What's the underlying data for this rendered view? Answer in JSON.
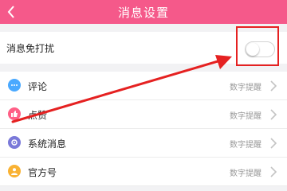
{
  "header": {
    "title": "消息设置"
  },
  "dnd": {
    "label": "消息免打扰",
    "enabled": false
  },
  "items": [
    {
      "label": "评论",
      "value": "数字提醒",
      "icon": "comment-icon",
      "color": "#4aa9ff"
    },
    {
      "label": "点赞",
      "value": "数字提醒",
      "icon": "thumbs-up-icon",
      "color": "#ff5f86"
    },
    {
      "label": "系统消息",
      "value": "数字提醒",
      "icon": "system-gear-icon",
      "color": "#7a79d9"
    },
    {
      "label": "官方号",
      "value": "数字提醒",
      "icon": "official-account-icon",
      "color": "#f9b234"
    }
  ],
  "colors": {
    "header": "#f5598a",
    "annotation": "#e52121"
  }
}
